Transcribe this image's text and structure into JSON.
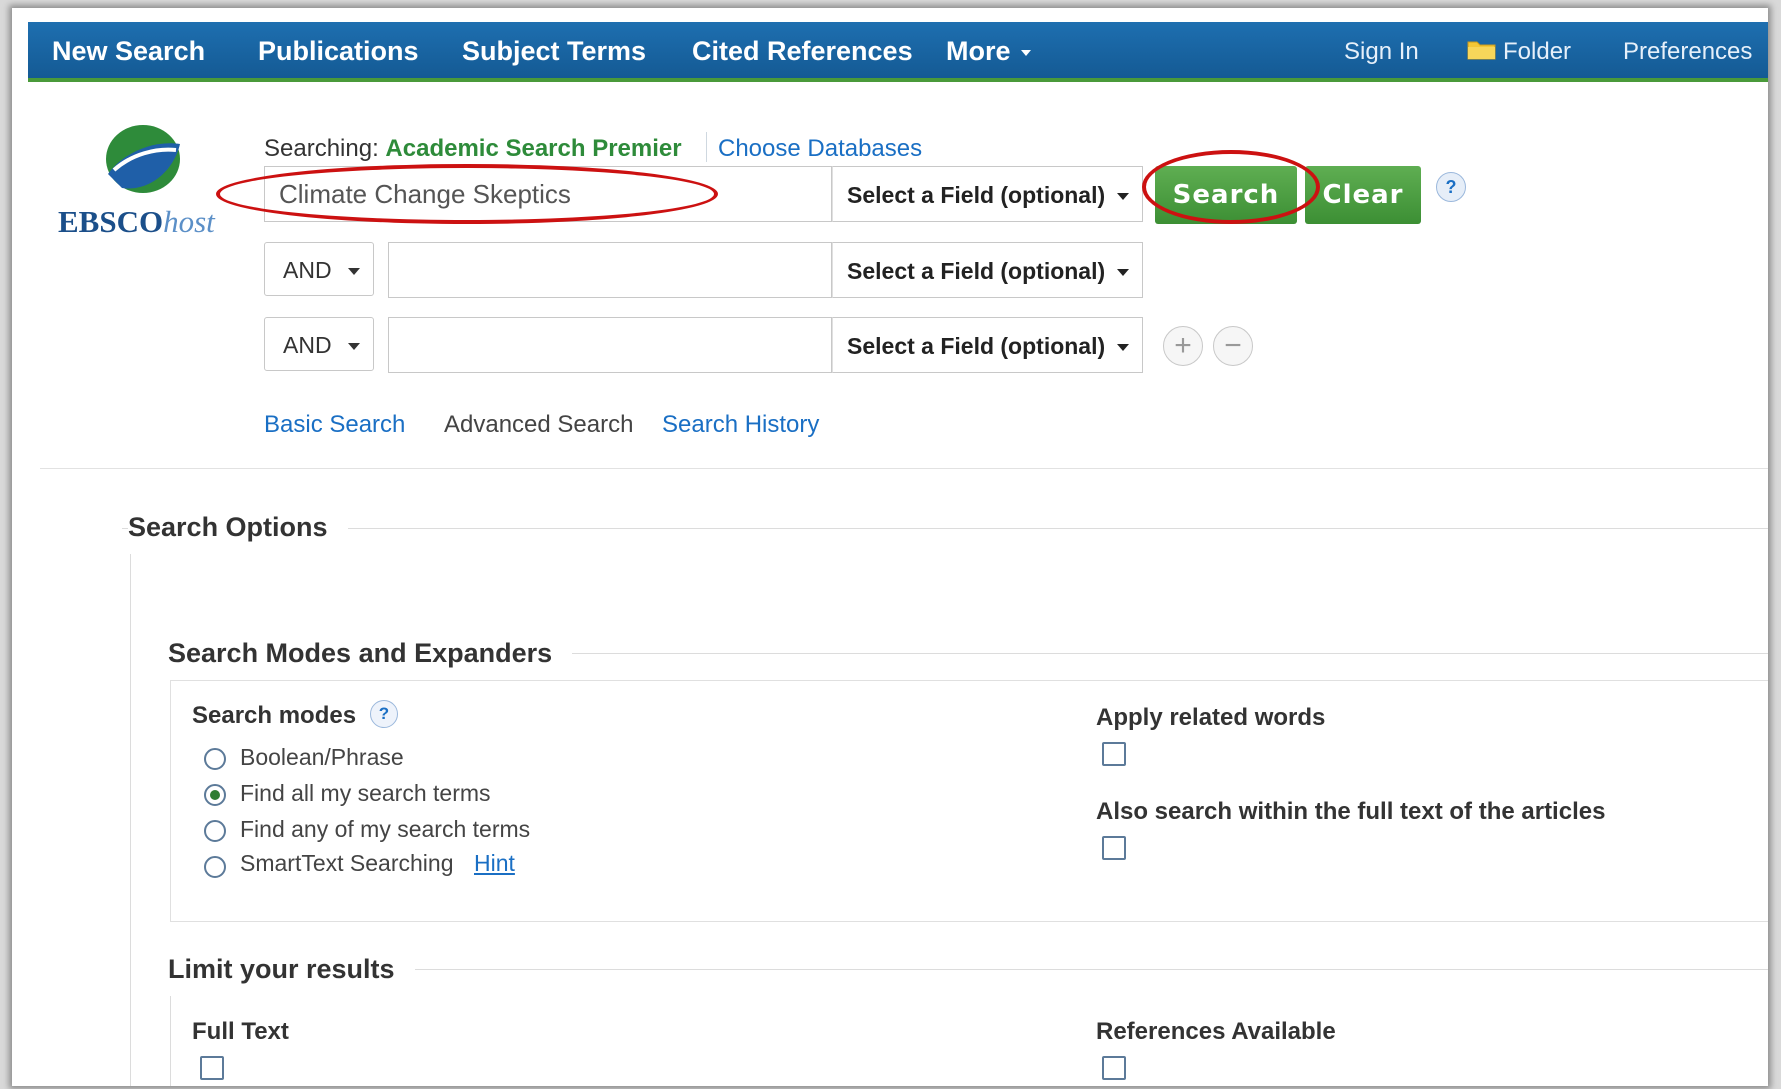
{
  "nav": {
    "left": [
      "New Search",
      "Publications",
      "Subject Terms",
      "Cited References",
      "More"
    ],
    "right": {
      "sign_in": "Sign In",
      "folder": "Folder",
      "preferences": "Preferences"
    }
  },
  "logo": {
    "brand": "EBSCO",
    "brand_suffix": "host"
  },
  "searching": {
    "prefix": "Searching:",
    "database": "Academic Search Premier",
    "choose": "Choose Databases"
  },
  "rows": [
    {
      "bool": "",
      "value": "Climate Change Skeptics",
      "field": "Select a Field (optional)"
    },
    {
      "bool": "AND",
      "value": "",
      "field": "Select a Field (optional)"
    },
    {
      "bool": "AND",
      "value": "",
      "field": "Select a Field (optional)"
    }
  ],
  "buttons": {
    "search": "Search",
    "clear": "Clear",
    "help": "?",
    "add": "+",
    "remove": "−"
  },
  "tabs": {
    "basic": "Basic Search",
    "advanced": "Advanced Search",
    "history": "Search History"
  },
  "options": {
    "title": "Search Options",
    "modes_section": "Search Modes and Expanders",
    "modes_label": "Search modes",
    "modes": [
      "Boolean/Phrase",
      "Find all my search terms",
      "Find any of my search terms",
      "SmartText Searching"
    ],
    "selected_mode": 1,
    "hint": "Hint",
    "apply_related": "Apply related words",
    "full_text_search": "Also search within the full text of the articles",
    "limit_section": "Limit your results",
    "full_text": "Full Text",
    "references": "References Available"
  },
  "colors": {
    "nav_blue": "#1a64a3",
    "green": "#4a9e40",
    "link": "#1a6fc4",
    "annotation_red": "#cc1111"
  }
}
